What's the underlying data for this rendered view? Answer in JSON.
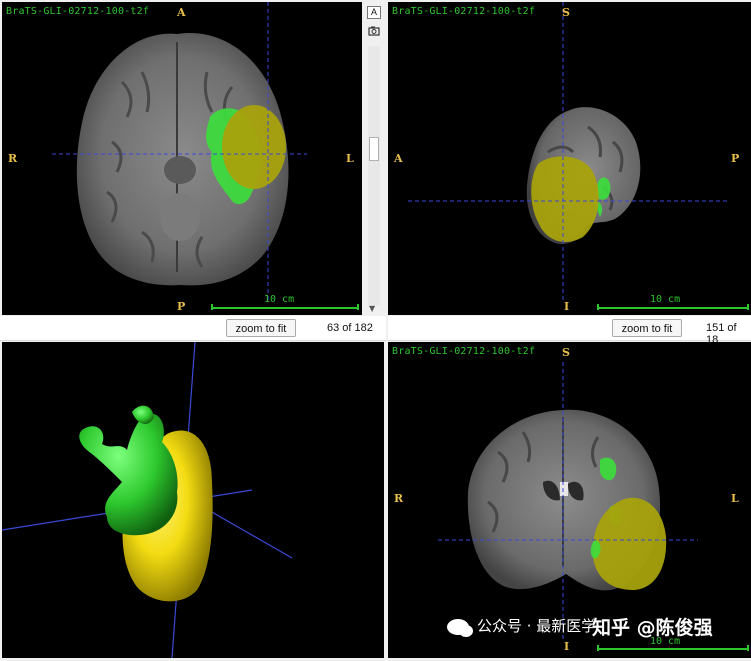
{
  "viewer": {
    "file_name": "BraTS-GLI-02712-100-t2f",
    "axial": {
      "top": "A",
      "bottom": "P",
      "left": "R",
      "right": "L",
      "scale": "10 cm",
      "zoom_button": "zoom to fit",
      "slice_counter": "63 of 182"
    },
    "sagittal": {
      "top": "S",
      "bottom": "I",
      "left": "A",
      "right": "P",
      "scale": "10 cm",
      "zoom_button": "zoom to fit",
      "slice_counter": "151 of 18"
    },
    "coronal": {
      "top": "S",
      "bottom": "I",
      "left": "R",
      "right": "L",
      "scale": "10 cm"
    },
    "render3d": {},
    "toolbar": {
      "a_button": "A",
      "camera_icon": "camera-icon"
    }
  },
  "overlay": {
    "watermark_text": "公众号 · 最新医学",
    "zhihu_text": "知乎 @陈俊强"
  },
  "colors": {
    "tumor_core": "#a8a20c",
    "edema": "#3ddc3d",
    "render_yellow": "#f3dc12",
    "render_green": "#2ec92e",
    "crosshair": "#3a49d6",
    "label_orange": "#e8c04a"
  }
}
